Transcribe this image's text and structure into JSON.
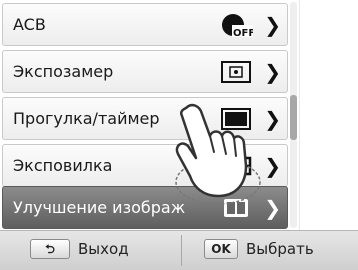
{
  "menu": {
    "items": [
      {
        "label": "ACB",
        "icon": "acb-off-icon"
      },
      {
        "label": "Экспозамер",
        "icon": "metering-icon"
      },
      {
        "label": "Прогулка/таймер",
        "icon": "drive-single-icon"
      },
      {
        "label": "Эксповилка",
        "icon": "bracket-icon"
      },
      {
        "label": "Улучшение изображ",
        "icon": "picture-wizard-icon"
      }
    ]
  },
  "bottom": {
    "back_label": "Выход",
    "ok_key": "OK",
    "select_label": "Выбрать"
  }
}
